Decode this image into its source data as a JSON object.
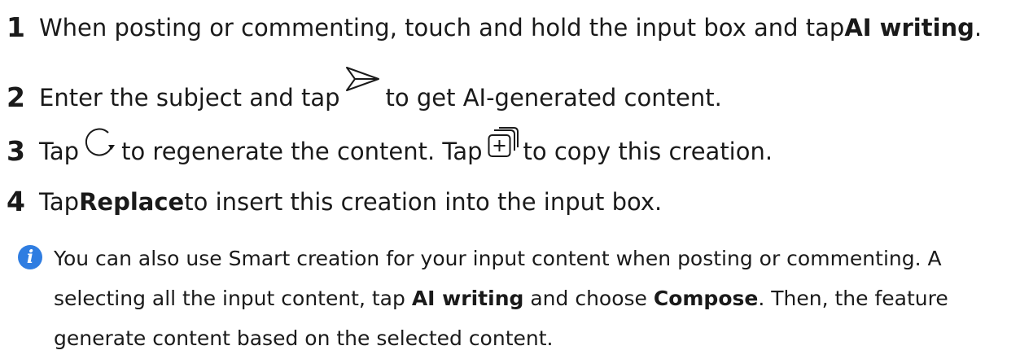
{
  "steps": [
    {
      "number": "1",
      "parts": [
        "When posting or commenting, touch and hold the input box and tap ",
        "AI writing",
        "."
      ]
    },
    {
      "number": "2",
      "parts": [
        "Enter the subject and tap ",
        " to get AI-generated content."
      ],
      "icon": "send-icon"
    },
    {
      "number": "3",
      "parts": [
        "Tap ",
        " to regenerate the content. Tap ",
        " to copy this creation."
      ],
      "icons": [
        "refresh-icon",
        "copy-icon"
      ]
    },
    {
      "number": "4",
      "parts": [
        "Tap ",
        "Replace",
        " to insert this creation into the input box."
      ]
    }
  ],
  "note": {
    "icon": "info-icon",
    "line1": "You can also use Smart creation for your input content when posting or commenting. A",
    "line2": {
      "a": "selecting all the input content, tap ",
      "b": "AI writing",
      "c": " and choose ",
      "d": "Compose",
      "e": ". Then, the feature"
    },
    "line3": "generate content based on the selected content."
  },
  "colors": {
    "info_icon": "#2f7de1",
    "text": "#1a1a1a"
  }
}
